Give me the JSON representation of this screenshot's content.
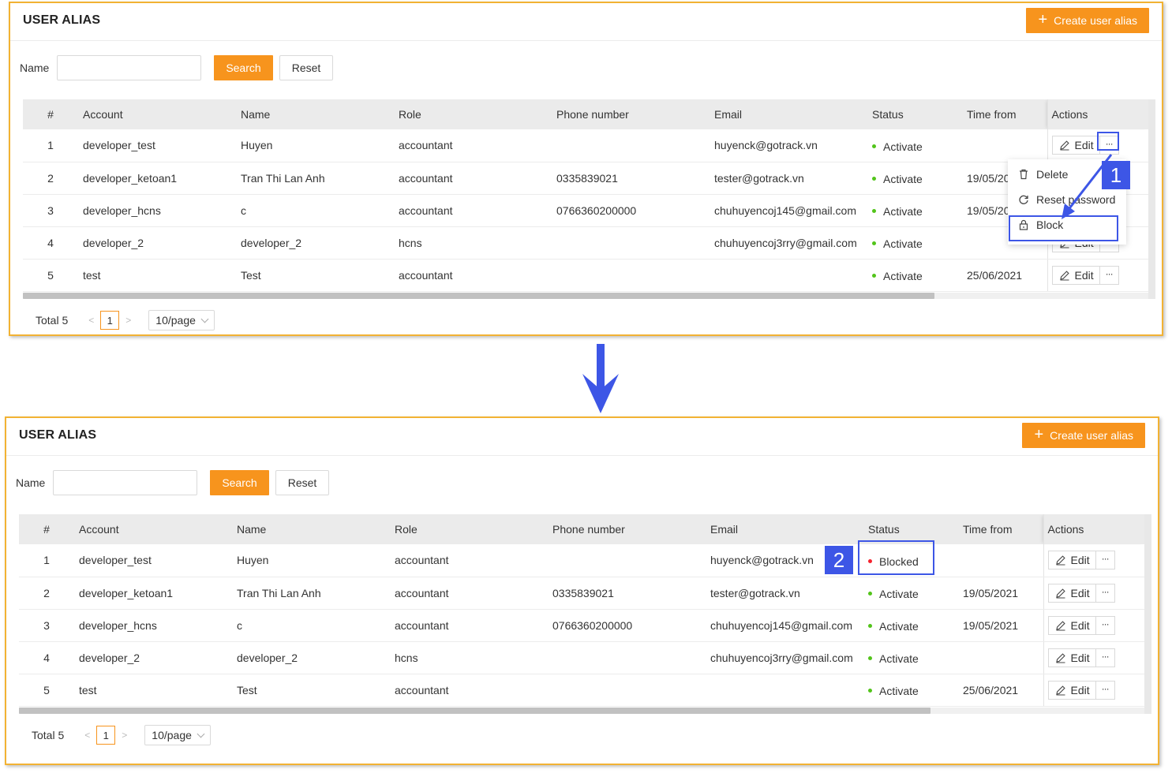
{
  "panels": [
    {
      "title": "USER ALIAS",
      "create_label": "Create user alias",
      "search": {
        "label": "Name",
        "value": "",
        "placeholder": "",
        "search_label": "Search",
        "reset_label": "Reset"
      },
      "columns": [
        "#",
        "Account",
        "Name",
        "Role",
        "Phone number",
        "Email",
        "Status",
        "Time from",
        "Actions"
      ],
      "rows": [
        {
          "idx": "1",
          "account": "developer_test",
          "name": "Huyen",
          "role": "accountant",
          "phone": "",
          "email": "huyenck@gotrack.vn",
          "status": "Activate",
          "time_from": ""
        },
        {
          "idx": "2",
          "account": "developer_ketoan1",
          "name": "Tran Thi Lan Anh",
          "role": "accountant",
          "phone": "0335839021",
          "email": "tester@gotrack.vn",
          "status": "Activate",
          "time_from": "19/05/2021"
        },
        {
          "idx": "3",
          "account": "developer_hcns",
          "name": "c",
          "role": "accountant",
          "phone": "0766360200000",
          "email": "chuhuyencoj145@gmail.com",
          "status": "Activate",
          "time_from": "19/05/2021"
        },
        {
          "idx": "4",
          "account": "developer_2",
          "name": "developer_2",
          "role": "hcns",
          "phone": "",
          "email": "chuhuyencoj3rry@gmail.com",
          "status": "Activate",
          "time_from": ""
        },
        {
          "idx": "5",
          "account": "test",
          "name": "Test",
          "role": "accountant",
          "phone": "",
          "email": "",
          "status": "Activate",
          "time_from": "25/06/2021"
        }
      ],
      "edit_label": "Edit",
      "more_label": "···",
      "pager": {
        "total": "Total 5",
        "page": "1",
        "page_size": "10/page"
      },
      "menu": {
        "delete": "Delete",
        "reset_password": "Reset password",
        "block": "Block"
      },
      "badge": "1"
    },
    {
      "title": "USER ALIAS",
      "create_label": "Create user alias",
      "search": {
        "label": "Name",
        "value": "",
        "placeholder": "",
        "search_label": "Search",
        "reset_label": "Reset"
      },
      "columns": [
        "#",
        "Account",
        "Name",
        "Role",
        "Phone number",
        "Email",
        "Status",
        "Time from",
        "Actions"
      ],
      "rows": [
        {
          "idx": "1",
          "account": "developer_test",
          "name": "Huyen",
          "role": "accountant",
          "phone": "",
          "email": "huyenck@gotrack.vn",
          "status": "Blocked",
          "time_from": ""
        },
        {
          "idx": "2",
          "account": "developer_ketoan1",
          "name": "Tran Thi Lan Anh",
          "role": "accountant",
          "phone": "0335839021",
          "email": "tester@gotrack.vn",
          "status": "Activate",
          "time_from": "19/05/2021"
        },
        {
          "idx": "3",
          "account": "developer_hcns",
          "name": "c",
          "role": "accountant",
          "phone": "0766360200000",
          "email": "chuhuyencoj145@gmail.com",
          "status": "Activate",
          "time_from": "19/05/2021"
        },
        {
          "idx": "4",
          "account": "developer_2",
          "name": "developer_2",
          "role": "hcns",
          "phone": "",
          "email": "chuhuyencoj3rry@gmail.com",
          "status": "Activate",
          "time_from": ""
        },
        {
          "idx": "5",
          "account": "test",
          "name": "Test",
          "role": "accountant",
          "phone": "",
          "email": "",
          "status": "Activate",
          "time_from": "25/06/2021"
        }
      ],
      "edit_label": "Edit",
      "more_label": "···",
      "pager": {
        "total": "Total 5",
        "page": "1",
        "page_size": "10/page"
      },
      "badge": "2"
    }
  ],
  "colors": {
    "accent": "#f7941d",
    "panel_border": "#f2b233",
    "annotation": "#3d56e6",
    "status_active": "#52c41a",
    "status_blocked": "#f5222d"
  },
  "icons": [
    "plus-icon",
    "edit-pencil-icon",
    "more-ellipsis-icon",
    "trash-icon",
    "reset-icon",
    "lock-icon",
    "chevron-left-icon",
    "chevron-right-icon",
    "chevron-down-icon",
    "down-arrow-icon"
  ]
}
